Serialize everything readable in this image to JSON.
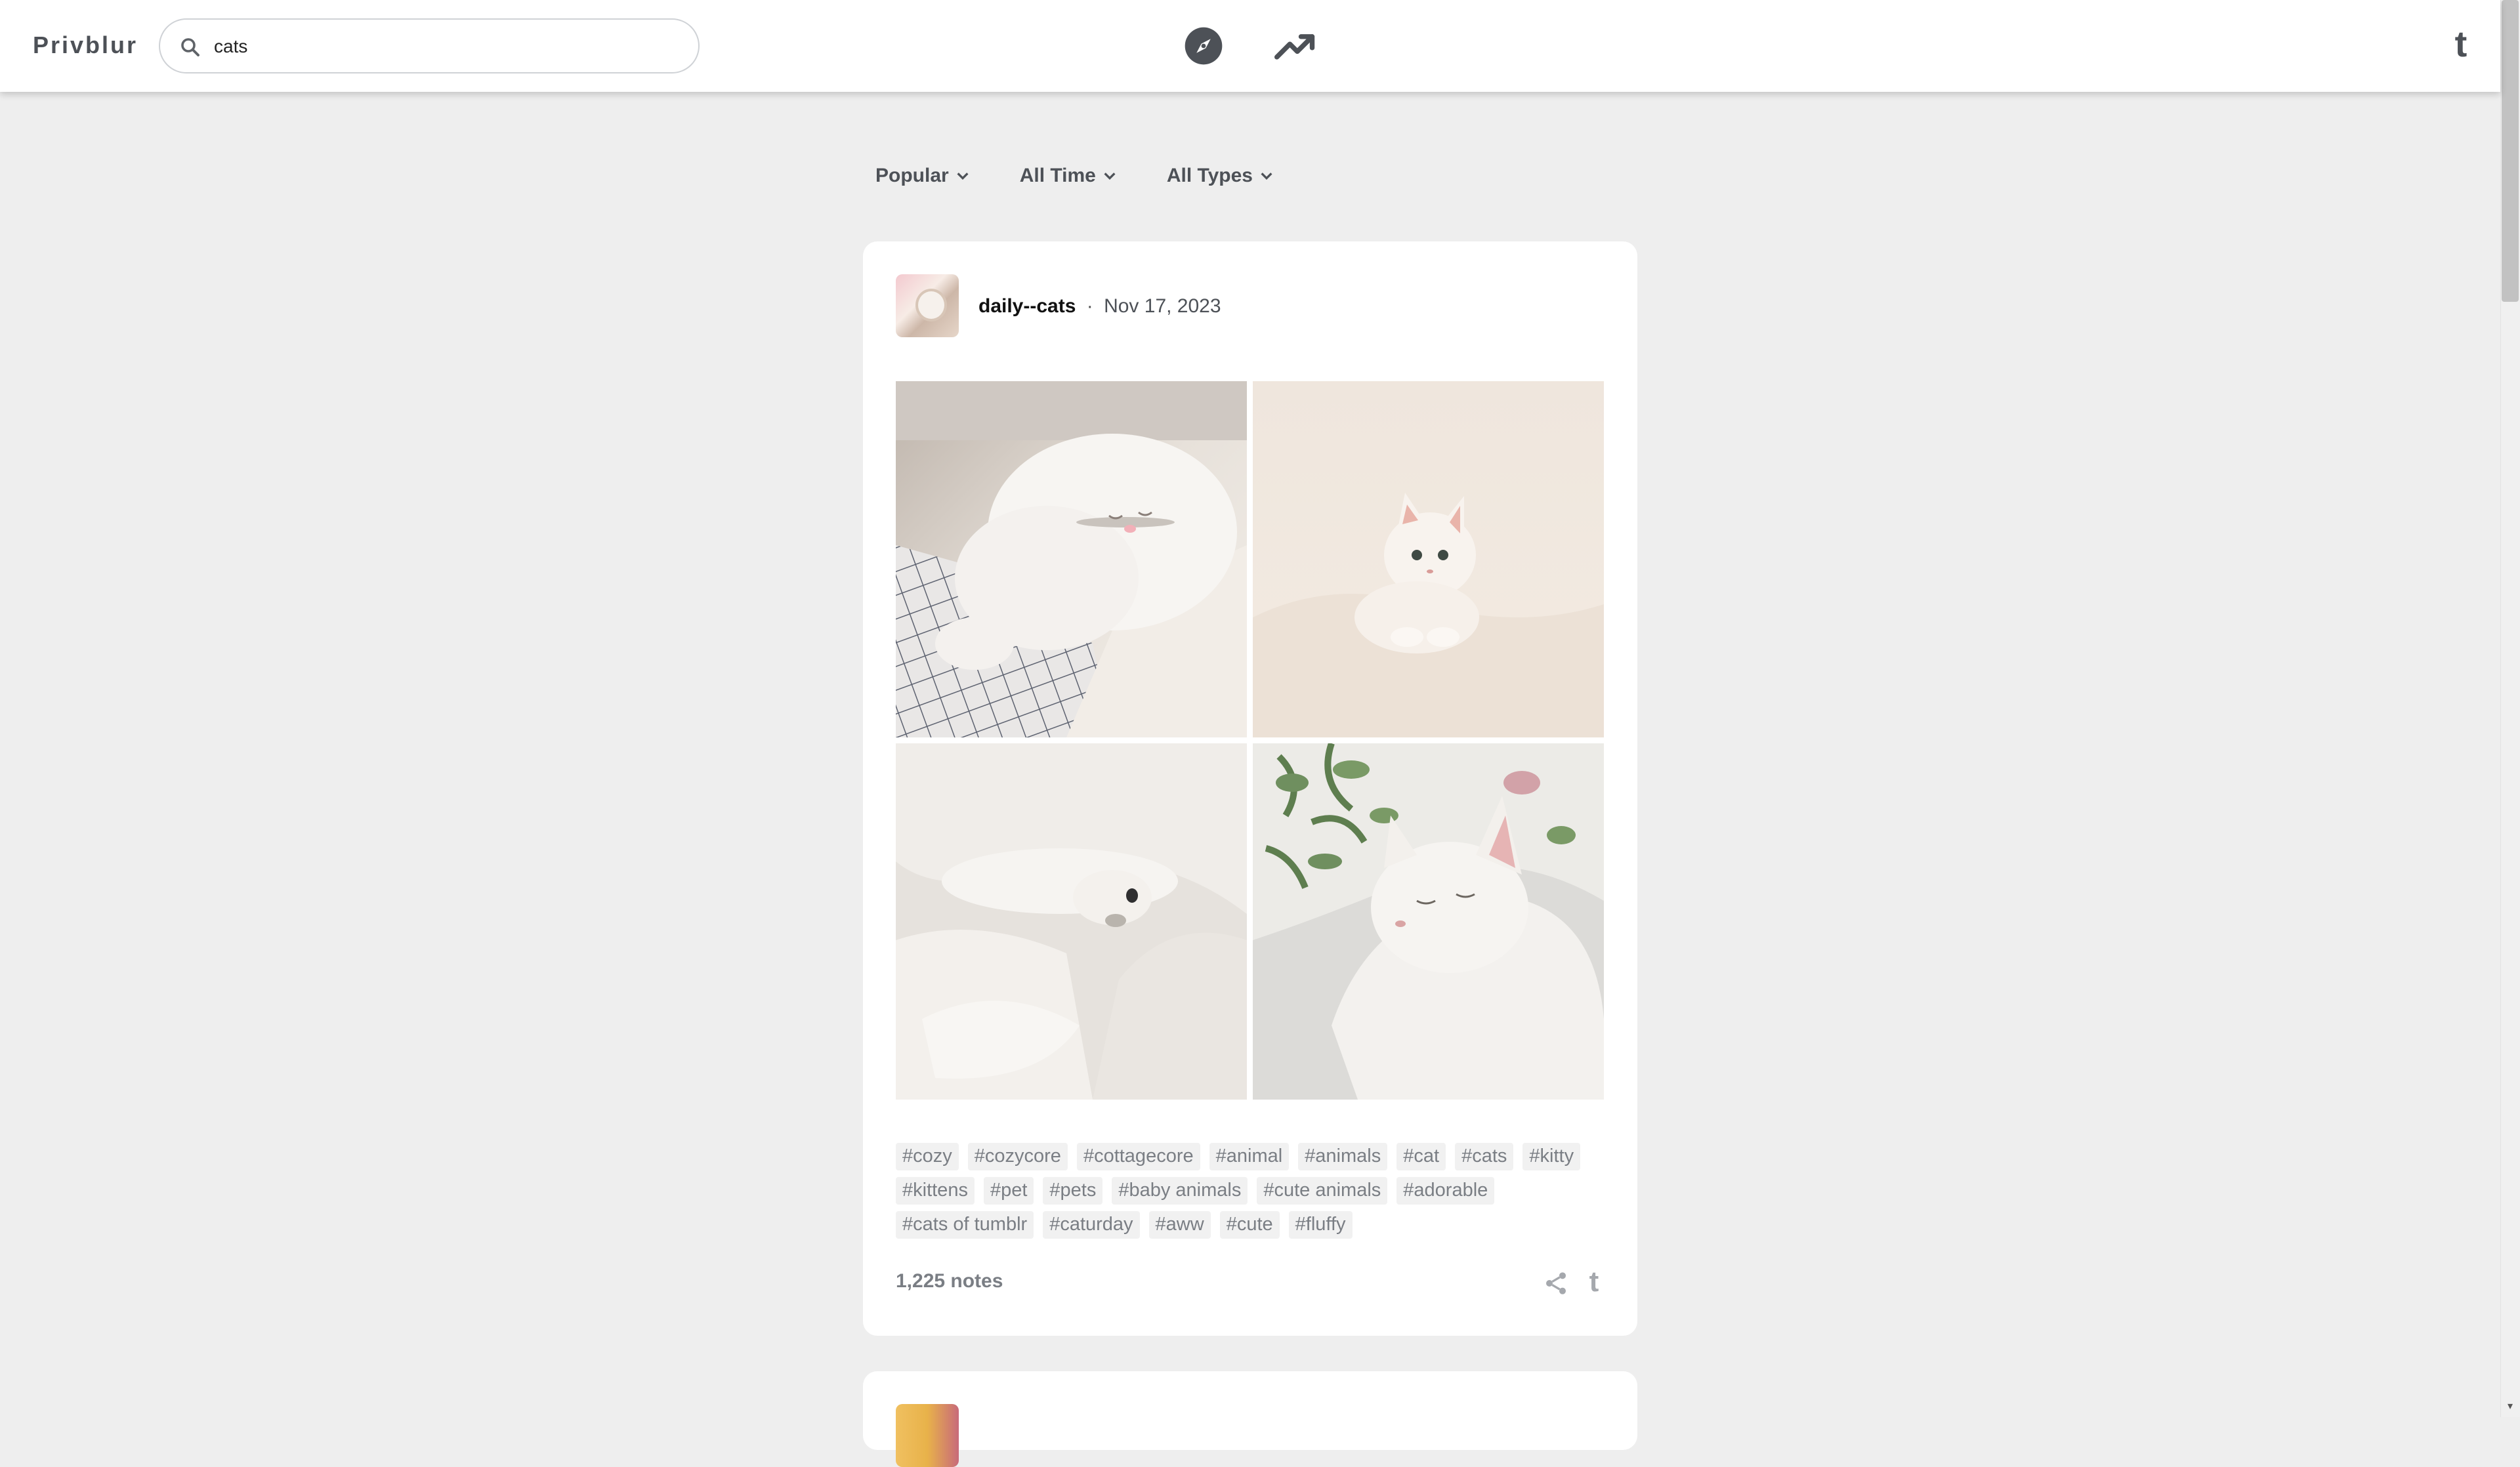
{
  "app": {
    "brand": "Privblur"
  },
  "search": {
    "value": "cats",
    "placeholder": ""
  },
  "nav": {
    "explore_icon": "compass-icon",
    "trending_icon": "trending-icon",
    "tumblr_label": "t"
  },
  "filters": [
    {
      "label": "Popular"
    },
    {
      "label": "All Time"
    },
    {
      "label": "All Types"
    }
  ],
  "post": {
    "username": "daily--cats",
    "separator": "·",
    "date": "Nov 17, 2023",
    "images": [
      {
        "alt": "white cat sleeping on plaid blanket"
      },
      {
        "alt": "white kitten lying on white sheets"
      },
      {
        "alt": "white cat peeking from white duvet"
      },
      {
        "alt": "white cat sleeping on floral pillow"
      }
    ],
    "tags": [
      "#cozy",
      "#cozycore",
      "#cottagecore",
      "#animal",
      "#animals",
      "#cat",
      "#cats",
      "#kitty",
      "#kittens",
      "#pet",
      "#pets",
      "#baby animals",
      "#cute animals",
      "#adorable",
      "#cats of tumblr",
      "#caturday",
      "#aww",
      "#cute",
      "#fluffy"
    ],
    "notes": "1,225 notes",
    "reblog_label": "t"
  },
  "colors": {
    "background": "#eeeeee",
    "card": "#ffffff",
    "muted_text": "#7a7e84",
    "brand_text": "#4d5157"
  }
}
